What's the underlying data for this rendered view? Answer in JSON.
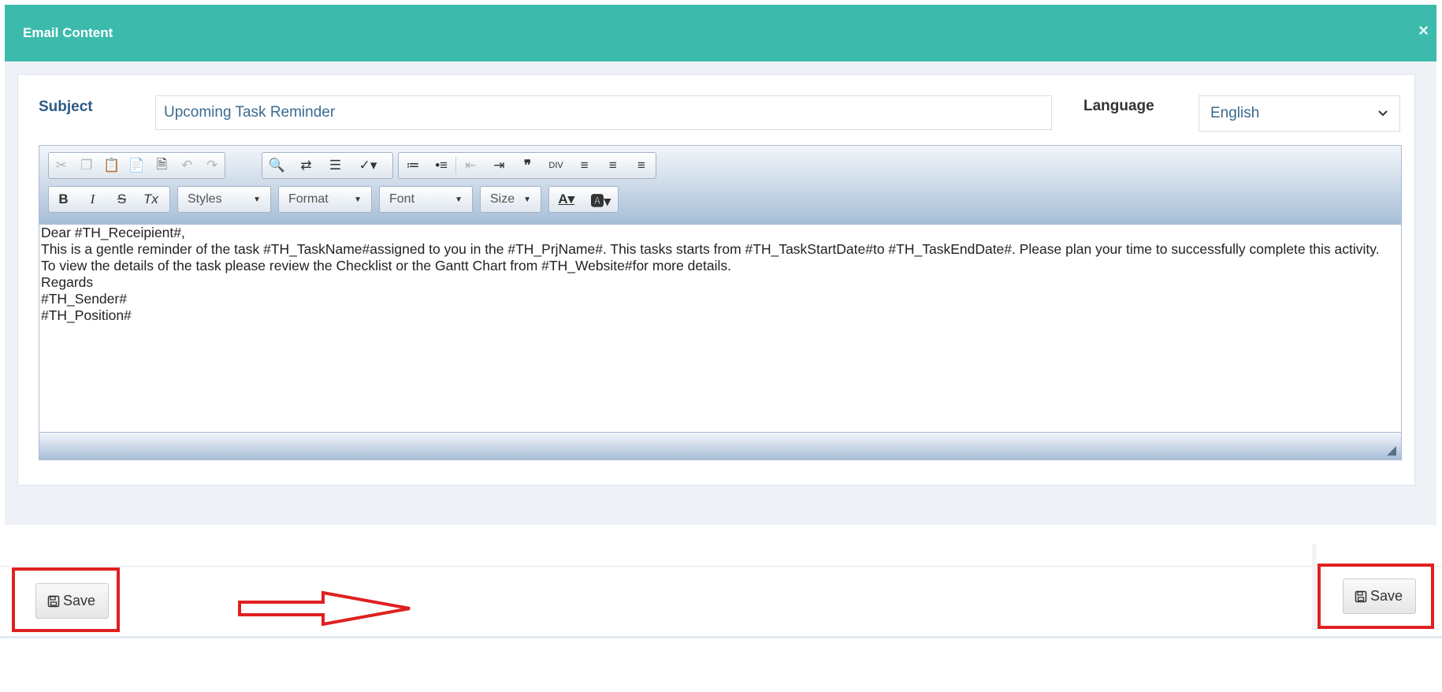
{
  "modal": {
    "title": "Email Content",
    "close_icon": "×"
  },
  "form": {
    "subject_label": "Subject",
    "subject_value": "Upcoming Task Reminder",
    "language_label": "Language",
    "language_value": "English"
  },
  "editor": {
    "toolbar": {
      "styles": "Styles",
      "format": "Format",
      "font": "Font",
      "size": "Size"
    },
    "body_lines": [
      "Dear #TH_Receipient#,",
      "This is a gentle reminder of the task #TH_TaskName#assigned to you in the #TH_PrjName#. This tasks starts from #TH_TaskStartDate#to #TH_TaskEndDate#. Please plan your time to successfully complete this activity. To view the details of the task please review the Checklist or the Gantt Chart from #TH_Website#for more details.",
      "Regards",
      "#TH_Sender#",
      "#TH_Position#"
    ]
  },
  "footer": {
    "save_left": "Save",
    "save_right": "Save"
  },
  "colors": {
    "header": "#3cbbad",
    "highlight": "#e02020"
  }
}
